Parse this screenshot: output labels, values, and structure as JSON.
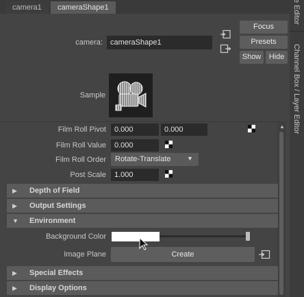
{
  "tabs": [
    "camera1",
    "cameraShape1"
  ],
  "side_panel": {
    "attr_editor_label": "e Editor",
    "channel_box_label": "Channel Box / Layer Editor"
  },
  "header": {
    "camera_label": "camera:",
    "camera_value": "cameraShape1",
    "focus": "Focus",
    "presets": "Presets",
    "show": "Show",
    "hide": "Hide",
    "sample_label": "Sample"
  },
  "film": {
    "pivot_label": "Film Roll Pivot",
    "pivot_x": "0.000",
    "pivot_y": "0.000",
    "value_label": "Film Roll Value",
    "value": "0.000",
    "order_label": "Film Roll Order",
    "order": "Rotate-Translate",
    "post_label": "Post Scale",
    "post": "1.000"
  },
  "sections": {
    "depth": "Depth of Field",
    "output": "Output Settings",
    "environment": "Environment",
    "special": "Special Effects",
    "display": "Display Options"
  },
  "environment": {
    "bg_label": "Background Color",
    "image_plane_label": "Image Plane",
    "create": "Create",
    "bg_color": "#ffffff"
  }
}
